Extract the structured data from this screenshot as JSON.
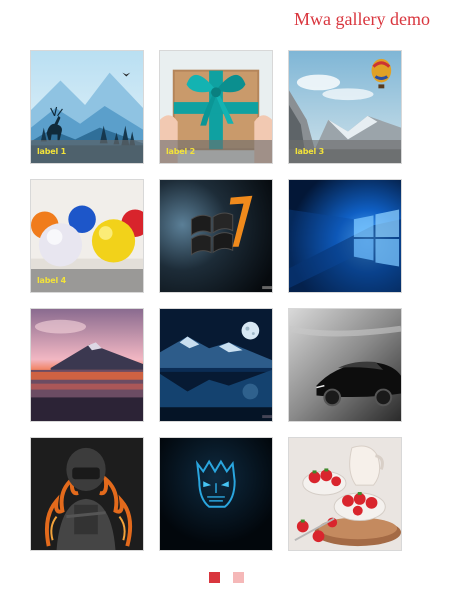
{
  "header": {
    "title": "Mwa gallery demo",
    "title_color": "#d9363e"
  },
  "gallery": {
    "items": [
      {
        "name": "deer-mountain-landscape",
        "label": "label 1"
      },
      {
        "name": "teal-ribbon-gift-box",
        "label": "label 2"
      },
      {
        "name": "hot-air-balloon-mountains",
        "label": "label 3"
      },
      {
        "name": "colorful-stress-balls",
        "label": "label 4"
      },
      {
        "name": "windows-7-logo",
        "label": ""
      },
      {
        "name": "windows-10-wallpaper",
        "label": ""
      },
      {
        "name": "sunset-volcano-lake",
        "label": ""
      },
      {
        "name": "moonlit-mountain-lake",
        "label": ""
      },
      {
        "name": "black-sports-car",
        "label": ""
      },
      {
        "name": "helmet-soldier-flames",
        "label": ""
      },
      {
        "name": "blue-ice-face-mask",
        "label": ""
      },
      {
        "name": "strawberries-cream-bowl",
        "label": ""
      }
    ],
    "caption_color": "#f2e23a"
  },
  "pagination": {
    "pages": 2,
    "current": 1,
    "active_color": "#d9363e",
    "inactive_color": "#f5b8b8"
  }
}
